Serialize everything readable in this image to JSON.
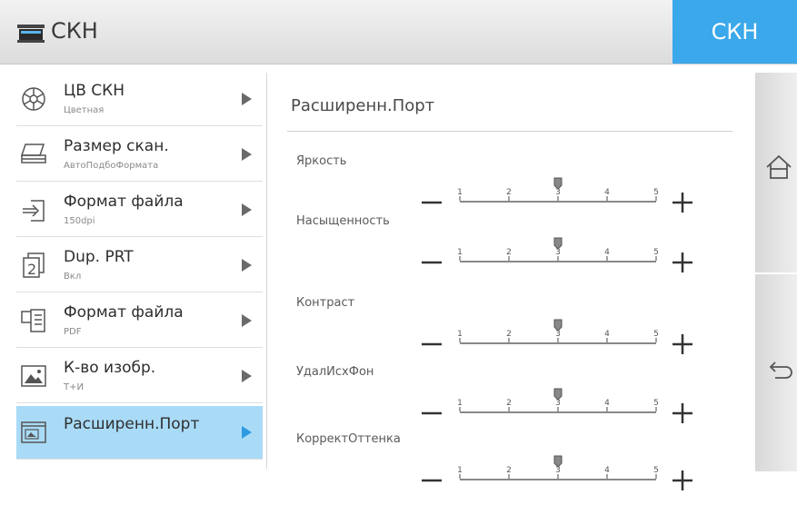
{
  "header": {
    "title": "СКН",
    "scan_button": "СКН",
    "logo_icon": "scanner-icon"
  },
  "menu": [
    {
      "label": "ЦВ СКН",
      "sub": "Цветная",
      "icon": "color-wheel-icon"
    },
    {
      "label": "Размер скан.",
      "sub": "АвтоПодбоФормата",
      "icon": "scanner-icon"
    },
    {
      "label": "Формат файла",
      "sub": "150dpi",
      "icon": "file-import-icon"
    },
    {
      "label": "Dup. PRT",
      "sub": "Вкл",
      "icon": "duplex-icon"
    },
    {
      "label": "Формат файла",
      "sub": "PDF",
      "icon": "file-format-icon"
    },
    {
      "label": "К-во изобр.",
      "sub": "Т+И",
      "icon": "image-icon"
    },
    {
      "label": "Расширенн.Порт",
      "sub": "",
      "icon": "advanced-icon",
      "active": true
    }
  ],
  "panel": {
    "title": "Расширенн.Порт",
    "ticks": [
      "1",
      "2",
      "3",
      "4",
      "5"
    ],
    "settings": [
      {
        "name": "Яркость",
        "value": 3
      },
      {
        "name": "Насыщенность",
        "value": 3
      },
      {
        "name": "Контраст",
        "value": 3
      },
      {
        "name": "УдалИсхФон",
        "value": 3
      },
      {
        "name": "КорректОттенка",
        "value": 3
      }
    ]
  },
  "sidebar": {
    "home_icon": "home-icon",
    "back_icon": "back-arrow-icon"
  },
  "colors": {
    "accent": "#3aa8ea",
    "active_item": "#a9dbf7"
  }
}
